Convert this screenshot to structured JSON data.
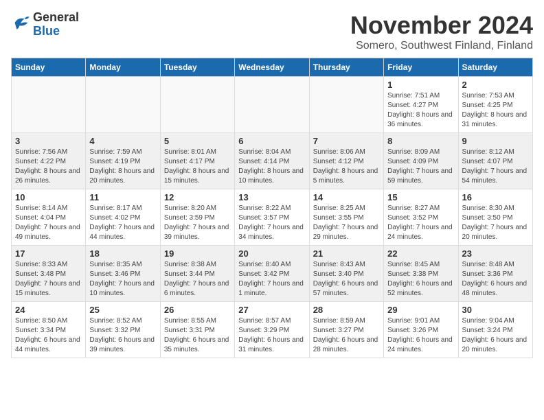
{
  "header": {
    "logo_general": "General",
    "logo_blue": "Blue",
    "month_title": "November 2024",
    "location": "Somero, Southwest Finland, Finland"
  },
  "weekdays": [
    "Sunday",
    "Monday",
    "Tuesday",
    "Wednesday",
    "Thursday",
    "Friday",
    "Saturday"
  ],
  "weeks": [
    [
      {
        "day": "",
        "info": ""
      },
      {
        "day": "",
        "info": ""
      },
      {
        "day": "",
        "info": ""
      },
      {
        "day": "",
        "info": ""
      },
      {
        "day": "",
        "info": ""
      },
      {
        "day": "1",
        "info": "Sunrise: 7:51 AM\nSunset: 4:27 PM\nDaylight: 8 hours and 36 minutes."
      },
      {
        "day": "2",
        "info": "Sunrise: 7:53 AM\nSunset: 4:25 PM\nDaylight: 8 hours and 31 minutes."
      }
    ],
    [
      {
        "day": "3",
        "info": "Sunrise: 7:56 AM\nSunset: 4:22 PM\nDaylight: 8 hours and 26 minutes."
      },
      {
        "day": "4",
        "info": "Sunrise: 7:59 AM\nSunset: 4:19 PM\nDaylight: 8 hours and 20 minutes."
      },
      {
        "day": "5",
        "info": "Sunrise: 8:01 AM\nSunset: 4:17 PM\nDaylight: 8 hours and 15 minutes."
      },
      {
        "day": "6",
        "info": "Sunrise: 8:04 AM\nSunset: 4:14 PM\nDaylight: 8 hours and 10 minutes."
      },
      {
        "day": "7",
        "info": "Sunrise: 8:06 AM\nSunset: 4:12 PM\nDaylight: 8 hours and 5 minutes."
      },
      {
        "day": "8",
        "info": "Sunrise: 8:09 AM\nSunset: 4:09 PM\nDaylight: 7 hours and 59 minutes."
      },
      {
        "day": "9",
        "info": "Sunrise: 8:12 AM\nSunset: 4:07 PM\nDaylight: 7 hours and 54 minutes."
      }
    ],
    [
      {
        "day": "10",
        "info": "Sunrise: 8:14 AM\nSunset: 4:04 PM\nDaylight: 7 hours and 49 minutes."
      },
      {
        "day": "11",
        "info": "Sunrise: 8:17 AM\nSunset: 4:02 PM\nDaylight: 7 hours and 44 minutes."
      },
      {
        "day": "12",
        "info": "Sunrise: 8:20 AM\nSunset: 3:59 PM\nDaylight: 7 hours and 39 minutes."
      },
      {
        "day": "13",
        "info": "Sunrise: 8:22 AM\nSunset: 3:57 PM\nDaylight: 7 hours and 34 minutes."
      },
      {
        "day": "14",
        "info": "Sunrise: 8:25 AM\nSunset: 3:55 PM\nDaylight: 7 hours and 29 minutes."
      },
      {
        "day": "15",
        "info": "Sunrise: 8:27 AM\nSunset: 3:52 PM\nDaylight: 7 hours and 24 minutes."
      },
      {
        "day": "16",
        "info": "Sunrise: 8:30 AM\nSunset: 3:50 PM\nDaylight: 7 hours and 20 minutes."
      }
    ],
    [
      {
        "day": "17",
        "info": "Sunrise: 8:33 AM\nSunset: 3:48 PM\nDaylight: 7 hours and 15 minutes."
      },
      {
        "day": "18",
        "info": "Sunrise: 8:35 AM\nSunset: 3:46 PM\nDaylight: 7 hours and 10 minutes."
      },
      {
        "day": "19",
        "info": "Sunrise: 8:38 AM\nSunset: 3:44 PM\nDaylight: 7 hours and 6 minutes."
      },
      {
        "day": "20",
        "info": "Sunrise: 8:40 AM\nSunset: 3:42 PM\nDaylight: 7 hours and 1 minute."
      },
      {
        "day": "21",
        "info": "Sunrise: 8:43 AM\nSunset: 3:40 PM\nDaylight: 6 hours and 57 minutes."
      },
      {
        "day": "22",
        "info": "Sunrise: 8:45 AM\nSunset: 3:38 PM\nDaylight: 6 hours and 52 minutes."
      },
      {
        "day": "23",
        "info": "Sunrise: 8:48 AM\nSunset: 3:36 PM\nDaylight: 6 hours and 48 minutes."
      }
    ],
    [
      {
        "day": "24",
        "info": "Sunrise: 8:50 AM\nSunset: 3:34 PM\nDaylight: 6 hours and 44 minutes."
      },
      {
        "day": "25",
        "info": "Sunrise: 8:52 AM\nSunset: 3:32 PM\nDaylight: 6 hours and 39 minutes."
      },
      {
        "day": "26",
        "info": "Sunrise: 8:55 AM\nSunset: 3:31 PM\nDaylight: 6 hours and 35 minutes."
      },
      {
        "day": "27",
        "info": "Sunrise: 8:57 AM\nSunset: 3:29 PM\nDaylight: 6 hours and 31 minutes."
      },
      {
        "day": "28",
        "info": "Sunrise: 8:59 AM\nSunset: 3:27 PM\nDaylight: 6 hours and 28 minutes."
      },
      {
        "day": "29",
        "info": "Sunrise: 9:01 AM\nSunset: 3:26 PM\nDaylight: 6 hours and 24 minutes."
      },
      {
        "day": "30",
        "info": "Sunrise: 9:04 AM\nSunset: 3:24 PM\nDaylight: 6 hours and 20 minutes."
      }
    ]
  ]
}
